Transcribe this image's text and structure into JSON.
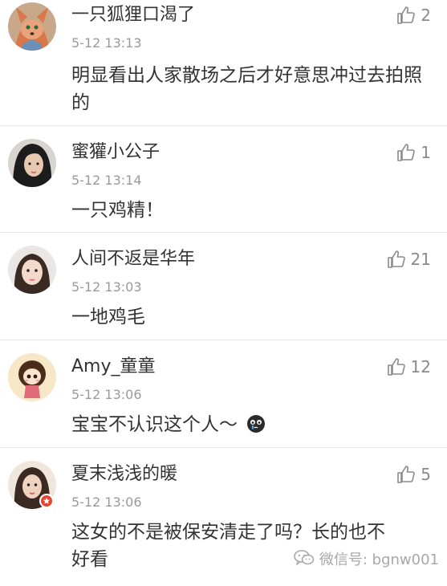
{
  "comments": [
    {
      "username": "一只狐狸口渴了",
      "time": "5-12 13:13",
      "likes": "2",
      "text": "明显看出人家散场之后才好意思冲过去拍照的"
    },
    {
      "username": "蜜獾小公子",
      "time": "5-12 13:14",
      "likes": "1",
      "text": "一只鸡精！"
    },
    {
      "username": "人间不返是华年",
      "time": "5-12 13:03",
      "likes": "21",
      "text": "一地鸡毛"
    },
    {
      "username": "Amy_童童",
      "time": "5-12 13:06",
      "likes": "12",
      "text": "宝宝不认识这个人～"
    },
    {
      "username": "夏末浅浅的暖",
      "time": "5-12 13:06",
      "likes": "5",
      "text": "这女的不是被保安清走了吗？长的也不好看"
    }
  ],
  "watermark": {
    "text": "微信号: bgnw001",
    "icon": "wechat-logo-icon"
  },
  "icons": {
    "like": "thumbs-up-icon",
    "emoji": "crying-face-emoji-icon",
    "badge": "verified-badge-icon"
  },
  "colors": {
    "text": "#333333",
    "time": "#9a9a9a",
    "like": "#8a8a8a",
    "divider": "#e6e6e6",
    "badge": "#e8432e"
  }
}
